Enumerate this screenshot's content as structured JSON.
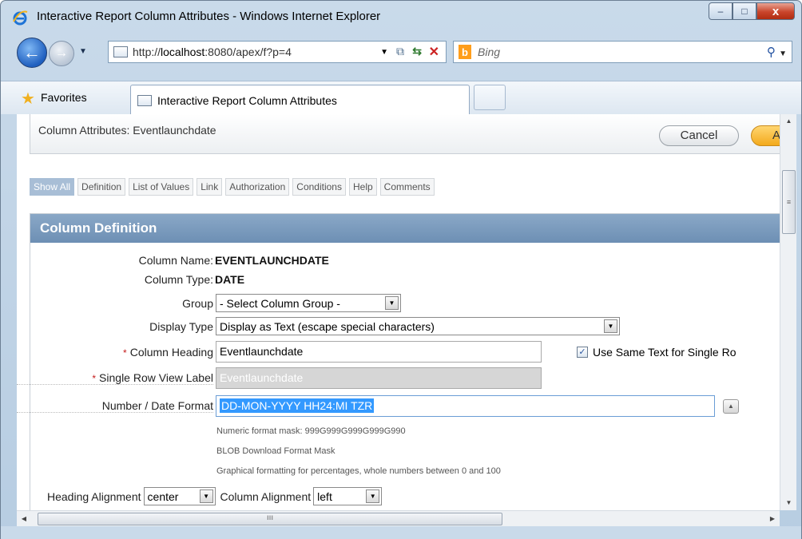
{
  "window": {
    "title": "Interactive Report Column Attributes - Windows Internet Explorer",
    "controls": {
      "minimize": "–",
      "maximize": "□",
      "close": "x"
    }
  },
  "toolbar": {
    "back": "←",
    "forward": "→",
    "dropdown": "▼",
    "url_prefix": "http://",
    "url_host": "localhost",
    "url_rest": ":8080/apex/f?p=4",
    "search_placeholder": "Bing",
    "search_logo": "b",
    "search_glyph": "⚲"
  },
  "favorites": {
    "label": "Favorites",
    "tab_label": "Interactive Report Column Attributes"
  },
  "page": {
    "attr_title": "Column Attributes: Eventlaunchdate",
    "cancel": "Cancel",
    "apply": "A",
    "tabs": [
      "Show All",
      "Definition",
      "List of Values",
      "Link",
      "Authorization",
      "Conditions",
      "Help",
      "Comments"
    ],
    "section_title": "Column Definition",
    "column_name_label": "Column Name:",
    "column_name_value": "EVENTLAUNCHDATE",
    "column_type_label": "Column Type:",
    "column_type_value": "DATE",
    "group_label": "Group",
    "group_value": "- Select Column Group -",
    "display_type_label": "Display Type",
    "display_type_value": "Display as Text (escape special characters)",
    "required_mark": "*",
    "column_heading_label": "Column Heading",
    "column_heading_value": "Eventlaunchdate",
    "same_text_label": "Use Same Text for Single Ro",
    "single_row_label": "Single Row View Label",
    "single_row_value": "Eventlaunchdate",
    "format_label": "Number / Date Format",
    "format_value": "DD-MON-YYYY HH24:MI TZR",
    "hint_numeric": "Numeric format mask: 999G999G999G999G990",
    "hint_blob": "BLOB Download Format Mask",
    "hint_graph": "Graphical formatting for percentages, whole numbers between 0 and 100",
    "heading_align_label": "Heading Alignment",
    "heading_align_value": "center",
    "column_align_label": "Column Alignment",
    "column_align_value": "left"
  },
  "scrollbar": {
    "grip": "≡",
    "hgrip": "ııı"
  }
}
